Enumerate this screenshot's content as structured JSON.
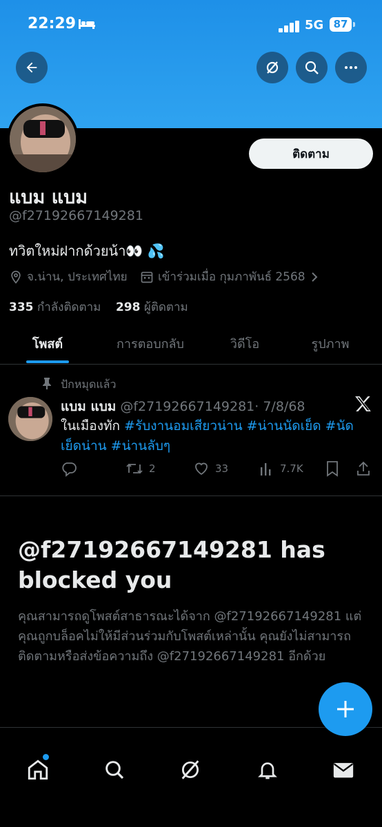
{
  "status_bar": {
    "time": "22:29",
    "network": "5G",
    "battery": "87"
  },
  "profile": {
    "follow_label": "ติดตาม",
    "name": "แบม แบม",
    "handle": "@f27192667149281",
    "bio": "ทวิตใหม่ฝากด้วยน้า👀 💦",
    "location": "จ.น่าน, ประเทศไทย",
    "joined": "เข้าร่วมเมื่อ กุมภาพันธ์ 2568",
    "following_count": "335",
    "following_label": "กำลังติดตาม",
    "followers_count": "298",
    "followers_label": "ผู้ติดตาม"
  },
  "tabs": [
    {
      "label": "โพสต์",
      "active": true
    },
    {
      "label": "การตอบกลับ",
      "active": false
    },
    {
      "label": "วิดีโอ",
      "active": false
    },
    {
      "label": "รูปภาพ",
      "active": false
    }
  ],
  "pinned_tweet": {
    "pinned_label": "ปักหมุดแล้ว",
    "author_name": "แบม แบม",
    "author_handle": "@f27192667149281",
    "date": "· 7/8/68",
    "text_prefix": "ในเมืองทัก ",
    "hashtags": "#รับงานอมเสียวน่าน #น่านนัดเย็ด #นัดเย็ดน่าน #น่านลับๆ",
    "reply_count": "",
    "retweet_count": "2",
    "like_count": "33",
    "view_count": "7.7K"
  },
  "blocked": {
    "title": "@f27192667149281 has blocked you",
    "description": "คุณสามารถดูโพสต์สาธารณะได้จาก @f27192667149281 แต่คุณถูกบล็อคไม่ให้มีส่วนร่วมกับโพสต์เหล่านั้น คุณยังไม่สามารถติดตามหรือส่งข้อความถึง @f27192667149281 อีกด้วย"
  },
  "colors": {
    "accent": "#1d9bf0",
    "banner": "#2fa3f0",
    "background": "#000000",
    "muted": "#71767b"
  },
  "icons": [
    "back-arrow-icon",
    "grok-icon",
    "search-icon",
    "more-icon",
    "location-icon",
    "calendar-icon",
    "chevron-right-icon",
    "pin-icon",
    "x-logo-icon",
    "reply-icon",
    "retweet-icon",
    "like-icon",
    "views-icon",
    "bookmark-icon",
    "share-icon",
    "compose-plus-icon",
    "home-icon",
    "explore-icon",
    "notifications-icon",
    "messages-icon"
  ]
}
